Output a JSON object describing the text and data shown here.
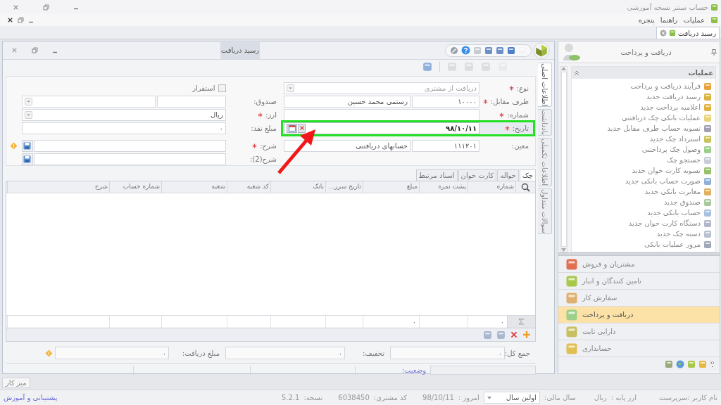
{
  "app_title": "حساب سنتر نسخه آموزشی",
  "menu": [
    "عملیات",
    "راهنما",
    "پنجره"
  ],
  "document_tabs": [
    {
      "label": "رسید دریافت",
      "selected": true
    }
  ],
  "document_window": {
    "title": "رسید دریافت"
  },
  "side_tabs": [
    {
      "label": "اطلاعات اصلی",
      "selected": true
    },
    {
      "label": "یادداشت",
      "selected": false
    },
    {
      "label": "اطلاعات تکمیلی",
      "selected": false
    },
    {
      "label": "سوالات متداول",
      "selected": false
    }
  ],
  "form": {
    "right_fields": [
      {
        "kind": "dropdown",
        "label": "نوع:",
        "required": true,
        "disabled": true,
        "value": "دریافت از مشتری"
      },
      {
        "kind": "pair",
        "label": "طرف مقابل:",
        "required": true,
        "code": "۱۰۰۰۰",
        "value": "رستمی محمد حسین"
      },
      {
        "kind": "text",
        "label": "شماره:",
        "required": true
      },
      {
        "kind": "date",
        "label": "تاریخ:",
        "required": true,
        "value": "۹۸/۱۰/۱۱",
        "highlighted": true
      },
      {
        "kind": "pair",
        "label": "معین:",
        "required": false,
        "code": "۱۱۱۲۰۱",
        "value": "حسابهای دریافتنی"
      }
    ],
    "left_fields": [
      {
        "kind": "checkbox",
        "label": "استقرار",
        "checked": false
      },
      {
        "kind": "pair_dropdown",
        "label": "صندوق:",
        "required": false
      },
      {
        "kind": "dropdown",
        "label": "ارز:",
        "required": true,
        "value": "ریال"
      },
      {
        "kind": "amount",
        "label": "مبلغ نقد:",
        "required": false,
        "value": "۰"
      },
      {
        "kind": "memo",
        "label": "شرح:",
        "required": true,
        "warning": true
      },
      {
        "kind": "memo",
        "label": "شرح(2):",
        "required": false,
        "warning": false
      }
    ]
  },
  "grid": {
    "tabs": [
      {
        "label": "چک",
        "selected": true
      },
      {
        "label": "حواله",
        "selected": false
      },
      {
        "label": "کارت خوان",
        "selected": false
      },
      {
        "label": "اسناد مرتبط",
        "selected": false
      }
    ],
    "columns": [
      "شماره",
      "پشت نمره",
      "مبلغ",
      "تاریخ سرر...",
      "بانک",
      "کد شعبه",
      "شعبه",
      "شماره حساب",
      "شرح"
    ],
    "sum_row": [
      {
        "kind": "value",
        "text": "۰"
      },
      {
        "kind": "blank"
      },
      {
        "kind": "value",
        "text": "۰"
      },
      {
        "kind": "blank"
      },
      {
        "kind": "blank"
      },
      {
        "kind": "blank"
      },
      {
        "kind": "blank"
      },
      {
        "kind": "blank"
      },
      {
        "kind": "blank"
      }
    ]
  },
  "totals": [
    {
      "label": "جمع کل:",
      "value": "۰"
    },
    {
      "label": "تخفیف:",
      "value": "۰"
    },
    {
      "label": "مبلغ دریافت:",
      "value": "۰"
    }
  ],
  "status_label": "وضعیت:",
  "desk_button": "میز کار",
  "side_panel": {
    "title": "دریافت و پرداخت",
    "section": {
      "title": "عملیات",
      "expanded": true
    },
    "items": [
      "فرآیند دریافت و پرداخت",
      "رسید دریافت جدید",
      "اعلامیه پرداخت جدید",
      "عملیات بانکی چک دریافتنی",
      "تسویه حساب طرف مقابل جدید",
      "استرداد چک جدید",
      "وصول چک پرداختنی",
      "جستجو چک",
      "تسویه کارت خوان جدید",
      "صورت حساب بانکی جدید",
      "مغایرت بانکی جدید",
      "صندوق جدید",
      "حساب بانکی جدید",
      "دستگاه کارت خوان جدید",
      "دسته چک جدید",
      "مرور عملیات بانکی"
    ],
    "nav": [
      {
        "label": "مشتریان و فروش",
        "selected": false
      },
      {
        "label": "تامین کنندگان و انبار",
        "selected": false
      },
      {
        "label": "سفارش کار",
        "selected": false
      },
      {
        "label": "دریافت و پرداخت",
        "selected": true
      },
      {
        "label": "دارایی ثابت",
        "selected": false
      },
      {
        "label": "حسابداری",
        "selected": false
      }
    ]
  },
  "status_bar": {
    "user": "نام کاربر :سرپرست",
    "base_currency_label": "ارز پایه :",
    "base_currency": "ریال",
    "fiscal_year_label": "سال مالی:",
    "fiscal_year": "اولین سال",
    "today_label": "امروز :",
    "today": "98/10/11",
    "customer_code_label": "کد مشتری:",
    "customer_code": "6038450",
    "version_label": "نسخه:",
    "version": "5.2.1",
    "support_link": "پشتیبانی و آموزش"
  }
}
